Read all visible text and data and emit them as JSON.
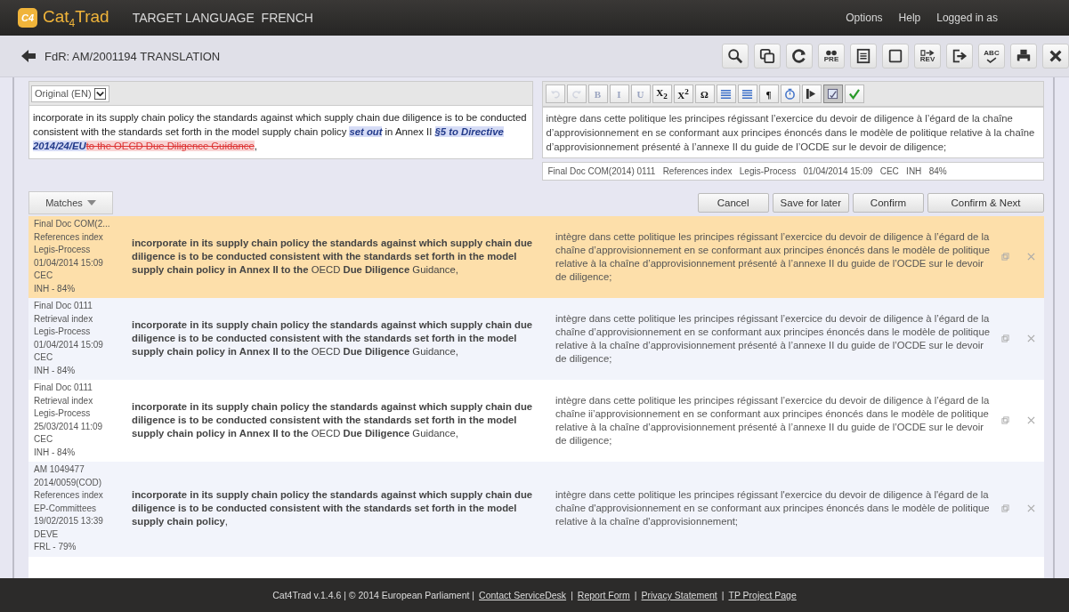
{
  "app": {
    "name_prefix": "Cat",
    "name_sub": "4",
    "name_suffix": "Trad",
    "logo_mark": "C4",
    "title": "TARGET LANGUAGE  FRENCH"
  },
  "menu": [
    "Options",
    "Help",
    "Logged in as"
  ],
  "document": {
    "title": "FdR: AM/2001194 TRANSLATION"
  },
  "toolbar": [
    {
      "kind": "search"
    },
    {
      "kind": "copy"
    },
    {
      "kind": "refresh"
    },
    {
      "kind": "pre",
      "label": "PRE"
    },
    {
      "kind": "document"
    },
    {
      "kind": "square"
    },
    {
      "kind": "rev",
      "label": "REV"
    },
    {
      "kind": "exit"
    },
    {
      "kind": "spell",
      "label": "ABC"
    },
    {
      "kind": "print"
    },
    {
      "kind": "close"
    }
  ],
  "source": {
    "language": "Original (EN)",
    "segments": [
      {
        "kind": "plain",
        "text": "incorporate in its supply chain policy the standards against which supply chain due diligence is to be conducted consistent with the standards set forth in the model supply chain policy "
      },
      {
        "kind": "inserted",
        "text": "set out"
      },
      {
        "kind": "plain",
        "text": " in Annex II "
      },
      {
        "kind": "inserted",
        "text": "§5 to Directive 2014/24/EU"
      },
      {
        "kind": "deleted",
        "text": "to the OECD Due Diligence Guidance"
      },
      {
        "kind": "plain",
        "text": ","
      }
    ]
  },
  "format_toolbar": [
    {
      "kind": "undo",
      "disabled": true,
      "pressed": false
    },
    {
      "kind": "redo",
      "disabled": true,
      "pressed": false
    },
    {
      "kind": "glyph",
      "text": "B",
      "disabled": true,
      "pressed": false
    },
    {
      "kind": "glyph",
      "text": "I",
      "disabled": true,
      "pressed": false
    },
    {
      "kind": "glyph",
      "text": "U",
      "disabled": true,
      "pressed": false
    },
    {
      "kind": "glyph",
      "text": "X$_{2}$",
      "disabled": false,
      "pressed": false
    },
    {
      "kind": "glyph",
      "text": "X$^{2}$",
      "disabled": false,
      "pressed": false
    },
    {
      "kind": "glyph",
      "text": "Ω",
      "disabled": false,
      "pressed": false
    },
    {
      "kind": "list",
      "disabled": false,
      "pressed": false
    },
    {
      "kind": "list",
      "disabled": false,
      "pressed": false
    },
    {
      "kind": "glyph",
      "text": "¶",
      "disabled": false,
      "pressed": false
    },
    {
      "kind": "timer",
      "disabled": false,
      "pressed": false
    },
    {
      "kind": "arrow",
      "disabled": false,
      "pressed": false
    },
    {
      "kind": "note",
      "disabled": false,
      "pressed": true
    },
    {
      "kind": "spell",
      "disabled": false,
      "pressed": false
    }
  ],
  "target": {
    "text": "intègre dans cette politique les principes régissant l’exercice du devoir de diligence à l’égard de la chaîne d’approvisionnement en se conformant aux principes énoncés dans le modèle de politique relative à la chaîne d’approvisionnement présenté à l’annexe II du guide de l’OCDE sur le devoir de diligence;",
    "info": "Final Doc COM(2014) 0111   References index   Legis-Process   01/04/2014 15:09   CEC   INH   84%"
  },
  "matches_button": "Matches",
  "actions": [
    "Cancel",
    "Save for later",
    "Confirm",
    "Confirm & Next"
  ],
  "matches": [
    {
      "selected": true,
      "meta": [
        "Final Doc COM(2...",
        "References index",
        "Legis-Process",
        "01/04/2014 15:09",
        "CEC",
        "INH - 84%"
      ],
      "source": "**incorporate in its supply chain policy the standards against which supply chain due diligence is to be conducted consistent with the standards set forth in the model supply chain policy in Annex II to the** OECD **Due Diligence** Guidance,",
      "target": "intègre dans cette politique les principes régissant l’exercice du devoir de diligence à l’égard de la chaîne d’approvisionnement en se conformant aux principes énoncés dans le modèle de politique relative à la chaîne d’approvisionnement présenté à l’annexe II du guide de l’OCDE sur le devoir de diligence;"
    },
    {
      "selected": false,
      "meta": [
        "Final Doc 0111",
        "Retrieval index",
        "Legis-Process",
        "01/04/2014 15:09",
        "CEC",
        "INH - 84%"
      ],
      "source": "**incorporate in its supply chain policy the standards against which supply chain due diligence is to be conducted consistent with the standards set forth in the model supply chain policy in Annex II to the** OECD **Due Diligence** Guidance,",
      "target": "intègre dans cette politique les principes régissant l’exercice du devoir de diligence à l’égard de la chaîne d’approvisionnement en se conformant aux principes énoncés dans le modèle de politique relative à la chaîne d’approvisionnement présenté à l’annexe II du guide de l’OCDE sur le devoir de diligence;"
    },
    {
      "selected": false,
      "meta": [
        "Final Doc 0111",
        "Retrieval index",
        "Legis-Process",
        "25/03/2014 11:09",
        "CEC",
        "INH - 84%"
      ],
      "source": "**incorporate in its supply chain policy the standards against which supply chain due diligence is to be conducted consistent with the standards set forth in the model supply chain policy in Annex II to the** OECD **Due Diligence** Guidance,",
      "target": "intègre dans cette politique les principes régissant l’exercice du devoir de diligence à l’égard de la chaîne ii’approvisionnement en se conformant aux principes énoncés dans le modèle de politique relative à la chaîne d’approvisionnement présenté à l’annexe II du guide de l’OCDE sur le devoir de diligence;"
    },
    {
      "selected": false,
      "meta": [
        "AM 1049477",
        "2014/0059(COD)",
        "References index",
        "EP-Committees",
        "19/02/2015 13:39",
        "DEVE",
        "FRL - 79%"
      ],
      "source": "**incorporate in its supply chain policy the standards against which supply chain due diligence is to be conducted consistent with the standards set forth in the model supply chain policy**,",
      "target": "intègre dans cette politique les principes régissant l'exercice du devoir de diligence à l'égard de la chaîne d'approvisionnement en se conformant aux principes énoncés dans le modèle de politique relative à la chaîne d'approvisionnement;"
    }
  ],
  "footer": [
    {
      "kind": "text",
      "text": "Cat4Trad v.1.4.6 | © 2014 European Parliament |"
    },
    {
      "kind": "link",
      "text": "Contact ServiceDesk"
    },
    {
      "kind": "text",
      "text": "|"
    },
    {
      "kind": "link",
      "text": "Report Form"
    },
    {
      "kind": "text",
      "text": "|"
    },
    {
      "kind": "link",
      "text": "Privacy Statement"
    },
    {
      "kind": "text",
      "text": "|"
    },
    {
      "kind": "link",
      "text": "TP Project Page"
    }
  ]
}
